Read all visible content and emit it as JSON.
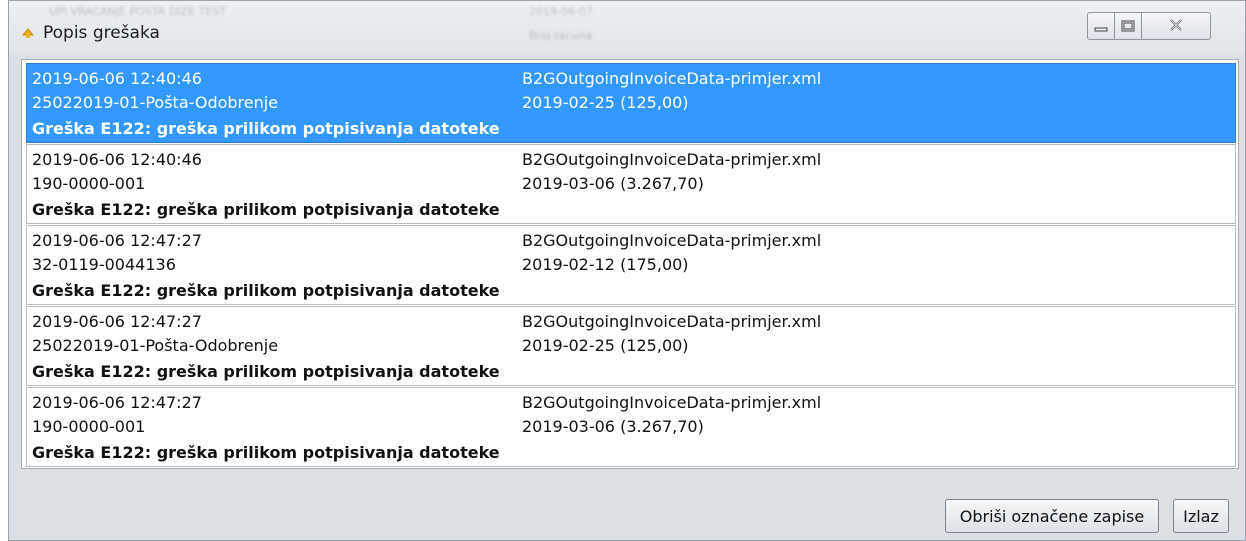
{
  "window": {
    "title": "Popis grešaka",
    "background_text_left": "UPI VRACANJE POSTA DIZE TEST",
    "background_text_date": "2019-06-07",
    "background_text_num": "Broj racuna",
    "controls": {
      "minimize": "minimize-icon",
      "maximize": "maximize-icon",
      "close": "close-icon"
    }
  },
  "rows": [
    {
      "timestamp": "2019-06-06 12:40:46",
      "reference": "25022019-01-Pošta-Odobrenje",
      "error": "Greška E122: greška prilikom potpisivanja datoteke",
      "file": "B2GOutgoingInvoiceData-primjer.xml",
      "date_amount": "2019-02-25 (125,00)"
    },
    {
      "timestamp": "2019-06-06 12:40:46",
      "reference": "190-0000-001",
      "error": "Greška E122: greška prilikom potpisivanja datoteke",
      "file": "B2GOutgoingInvoiceData-primjer.xml",
      "date_amount": "2019-03-06 (3.267,70)"
    },
    {
      "timestamp": "2019-06-06 12:47:27",
      "reference": "32-0119-0044136",
      "error": "Greška E122: greška prilikom potpisivanja datoteke",
      "file": "B2GOutgoingInvoiceData-primjer.xml",
      "date_amount": "2019-02-12 (175,00)"
    },
    {
      "timestamp": "2019-06-06 12:47:27",
      "reference": "25022019-01-Pošta-Odobrenje",
      "error": "Greška E122: greška prilikom potpisivanja datoteke",
      "file": "B2GOutgoingInvoiceData-primjer.xml",
      "date_amount": "2019-02-25 (125,00)"
    },
    {
      "timestamp": "2019-06-06 12:47:27",
      "reference": "190-0000-001",
      "error": "Greška E122: greška prilikom potpisivanja datoteke",
      "file": "B2GOutgoingInvoiceData-primjer.xml",
      "date_amount": "2019-03-06 (3.267,70)"
    }
  ],
  "selected_row": 0,
  "buttons": {
    "delete_label": "Obriši označene zapise",
    "exit_label": "Izlaz"
  },
  "colors": {
    "selection": "#3399ff",
    "window_bg": "#dcdfe3"
  }
}
